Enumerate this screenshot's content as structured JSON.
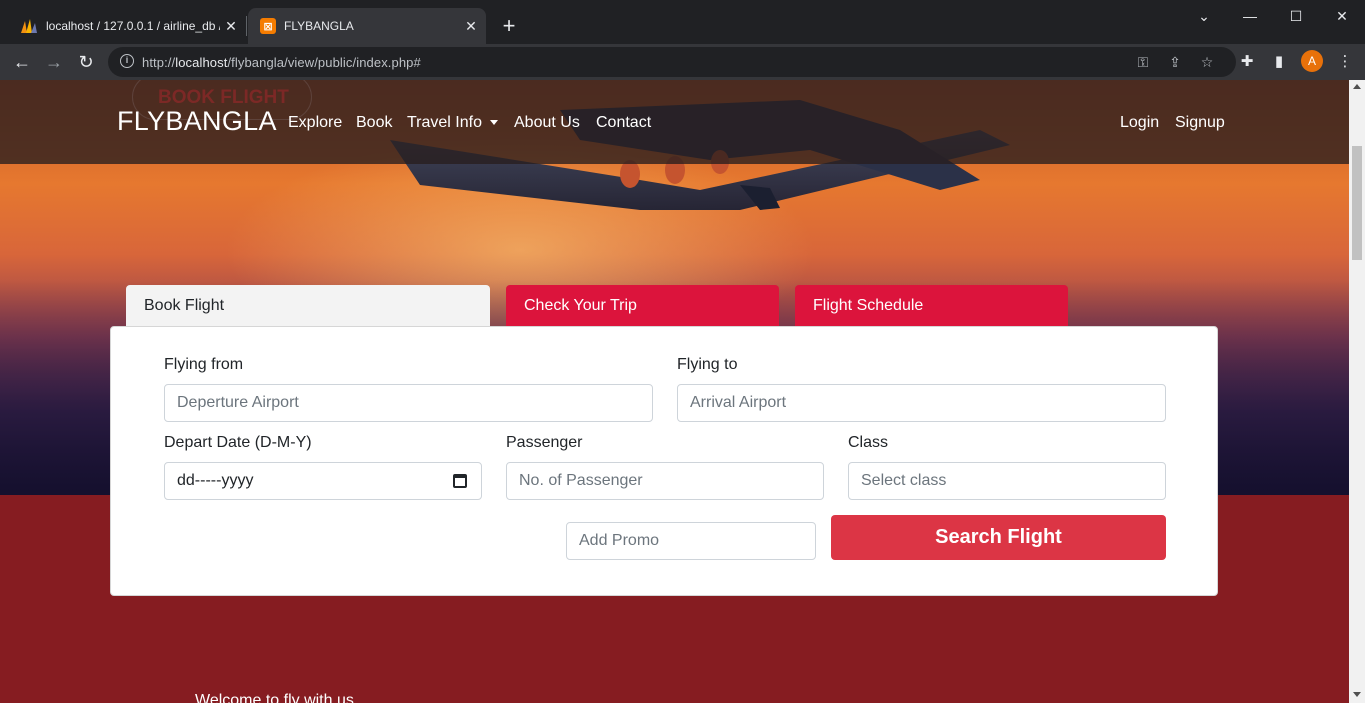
{
  "browser": {
    "tabs": [
      {
        "title": "localhost / 127.0.0.1 / airline_db /",
        "icon": "phpmyadmin-icon"
      },
      {
        "title": "FLYBANGLA",
        "icon": "xampp-icon"
      }
    ],
    "url_prefix": "http://",
    "url_host": "localhost",
    "url_path": "/flybangla/view/public/index.php#",
    "profile_initial": "A"
  },
  "header": {
    "ghost_text": "BOOK FLIGHT",
    "brand": "FLYBANGLA",
    "nav": [
      "Explore",
      "Book",
      "Travel Info",
      "About Us",
      "Contact"
    ],
    "auth": [
      "Login",
      "Signup"
    ]
  },
  "booking": {
    "tabs": [
      "Book Flight",
      "Check Your Trip",
      "Flight Schedule"
    ],
    "from_label": "Flying from",
    "from_placeholder": "Deperture Airport",
    "to_label": "Flying to",
    "to_placeholder": "Arrival Airport",
    "date_label": "Depart Date (D-M-Y)",
    "date_value": "dd-----yyyy",
    "passenger_label": "Passenger",
    "passenger_placeholder": "No. of Passenger",
    "class_label": "Class",
    "class_placeholder": "Select class",
    "promo_placeholder": "Add Promo",
    "search_label": "Search Flight"
  },
  "welcome_text": "Welcome to fly with us",
  "colors": {
    "accent": "#dc143c",
    "button": "#dc3545",
    "page_bg": "#861c21"
  }
}
